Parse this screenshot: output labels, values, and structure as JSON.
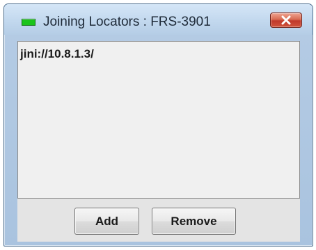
{
  "window": {
    "title": "Joining Locators : FRS-3901",
    "status_color": "#1bc41b"
  },
  "titlebar": {
    "close_icon": "close-x-icon"
  },
  "locators": [
    "jini://10.8.1.3/"
  ],
  "buttons": {
    "add_label": "Add",
    "remove_label": "Remove"
  }
}
